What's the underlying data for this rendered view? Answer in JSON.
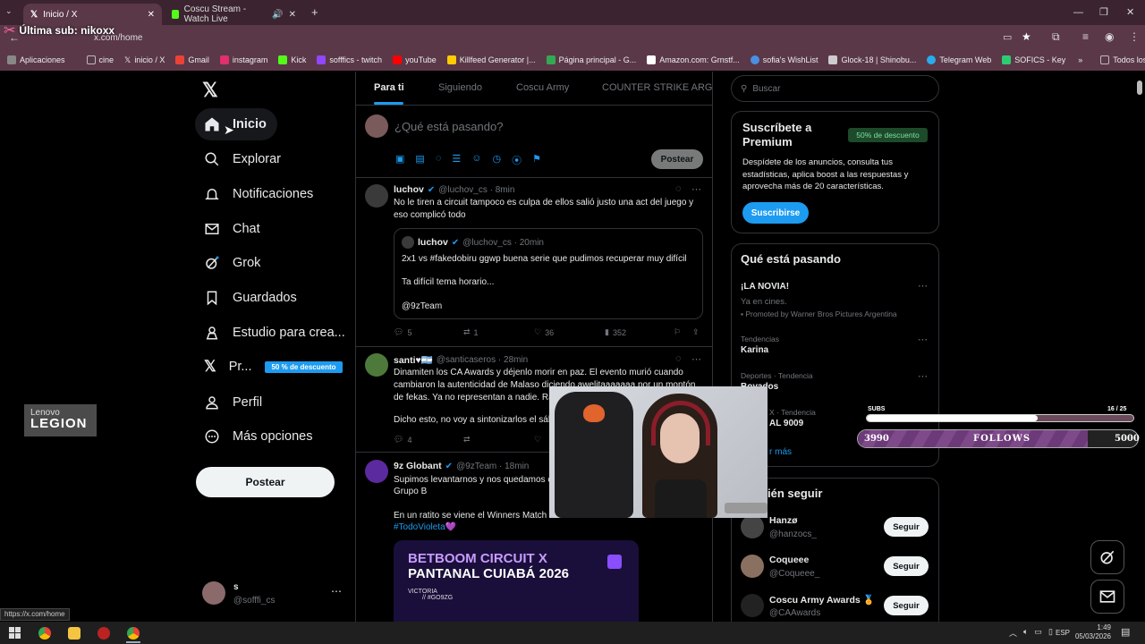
{
  "browser": {
    "tabs": [
      {
        "title": "Inicio / X"
      },
      {
        "title": "Coscu Stream - Watch Live"
      }
    ],
    "address": "x.com/home",
    "overlay_text": "Última sub: nikoxx",
    "bookmarks": [
      {
        "label": "Aplicaciones",
        "color": "#888888"
      },
      {
        "label": "cine",
        "color": "#bbbbbb"
      },
      {
        "label": "inicio / X",
        "color": "#ffffff"
      },
      {
        "label": "Gmail",
        "color": "#ea4335"
      },
      {
        "label": "instagram",
        "color": "#e1306c"
      },
      {
        "label": "Kick",
        "color": "#53fc18"
      },
      {
        "label": "sofffics - twitch",
        "color": "#9146ff"
      },
      {
        "label": "youTube",
        "color": "#ff0000"
      },
      {
        "label": "Killfeed Generator |...",
        "color": "#ffcc00"
      },
      {
        "label": "Página principal - G...",
        "color": "#34a853"
      },
      {
        "label": "Amazon.com: Grnstf...",
        "color": "#ffffff"
      },
      {
        "label": "sofia's WishList",
        "color": "#4a90e2"
      },
      {
        "label": "Glock-18 | Shinobu...",
        "color": "#cccccc"
      },
      {
        "label": "Telegram Web",
        "color": "#2aabee"
      },
      {
        "label": "SOFICS - Key",
        "color": "#2ecc71"
      }
    ],
    "all_bookmarks": "Todos los marcadores",
    "status_url": "https://x.com/home"
  },
  "nav": {
    "items": [
      {
        "label": "Inicio",
        "icon": "home-icon"
      },
      {
        "label": "Explorar",
        "icon": "search-icon"
      },
      {
        "label": "Notificaciones",
        "icon": "bell-icon"
      },
      {
        "label": "Chat",
        "icon": "mail-icon"
      },
      {
        "label": "Grok",
        "icon": "grok-icon"
      },
      {
        "label": "Guardados",
        "icon": "bookmark-icon"
      },
      {
        "label": "Estudio para crea...",
        "icon": "creator-icon"
      },
      {
        "label": "Pr...",
        "icon": "x-premium-icon"
      },
      {
        "label": "Perfil",
        "icon": "person-icon"
      },
      {
        "label": "Más opciones",
        "icon": "more-circle-icon"
      }
    ],
    "premium_badge": "50 % de descuento",
    "post_button": "Postear",
    "account": {
      "name": "s",
      "handle": "@sofffi_cs"
    }
  },
  "timeline": {
    "tabs": [
      "Para ti",
      "Siguiendo",
      "Coscu Army",
      "COUNTER STRIKE ARG"
    ],
    "composer_placeholder": "¿Qué está pasando?",
    "composer_post": "Postear",
    "tweets": [
      {
        "name": "luchov",
        "handle": "@luchov_cs · 8min",
        "text": "No le tiren a circuit tampoco es culpa de ellos salió justo una act del juego y eso complicó todo",
        "quote": {
          "name": "luchov",
          "handle": "@luchov_cs · 20min",
          "line1": "2x1 vs #fakedobiru ggwp buena serie que pudimos recuperar muy difícil",
          "line2": "Ta difícil tema horario...",
          "line3": "@9zTeam"
        },
        "replies": "5",
        "retweets": "1",
        "likes": "36",
        "views": "352"
      },
      {
        "name": "santi♥🇦🇷",
        "handle": "@santicaseros · 28min",
        "text": "Dinamiten los CA Awards y déjenlo morir en paz. El evento murió cuando cambiaron la autenticidad de Malaso diciendo awelitaaaaaaa por un montón de fekas. Ya no representan a nadie. Rac",
        "text2": "Dicho esto, no voy a sintonizarlos el sáb",
        "replies": "4"
      },
      {
        "name": "9z Globant",
        "handle": "@9zTeam · 18min",
        "text": "Supimos levantarnos y nos quedamos c",
        "text_b": "Grupo B",
        "text2": "En un ratito se viene el Winners Match",
        "hashtag": "#TodoVioleta💜",
        "media_title1": "BETBOOM CIRCUIT X",
        "media_title2": "PANTANAL CUIABÁ 2026",
        "media_small1": "VICTORIA",
        "media_small2": "// #GO9ZG"
      }
    ]
  },
  "sidebar": {
    "search_placeholder": "Buscar",
    "premium": {
      "title": "Suscríbete a Premium",
      "badge": "50% de descuento",
      "text": "Despídete de los anuncios, consulta tus estadísticas, aplica boost a las respuestas y aprovecha más de 20 características.",
      "button": "Suscribirse"
    },
    "trends_title": "Qué está pasando",
    "trends": [
      {
        "top": "",
        "title": "¡LA NOVIA!",
        "sub": "Ya en cines.",
        "promo": "Promoted by Warner Bros Pictures Argentina"
      },
      {
        "top": "Tendencias",
        "title": "Karina"
      },
      {
        "top": "Deportes · Tendencia",
        "title": "Boyados"
      },
      {
        "top": "X · Tendencia",
        "title": "AL 9009"
      }
    ],
    "show_more": "r más",
    "who_title": "ién seguir",
    "who": [
      {
        "name": "Hanzø",
        "handle": "@hanzocs_",
        "button": "Seguir"
      },
      {
        "name": "Coqueee",
        "handle": "@Coqueee_",
        "button": "Seguir"
      },
      {
        "name": "Coscu Army Awards 🏅",
        "handle": "@CAAwards",
        "button": "Seguir"
      }
    ]
  },
  "stream_overlay": {
    "subs_label": "SUBS",
    "subs_count": "16 / 25",
    "subs_progress": 0.64,
    "follows_start": "3990",
    "follows_label": "FOLLOWS",
    "follows_end": "5000",
    "follows_progress": 0.82,
    "sponsor_line1": "Lenovo",
    "sponsor_line2": "LEGION"
  },
  "taskbar": {
    "lang": "ESP",
    "time": "1:49",
    "date": "05/03/2026"
  }
}
